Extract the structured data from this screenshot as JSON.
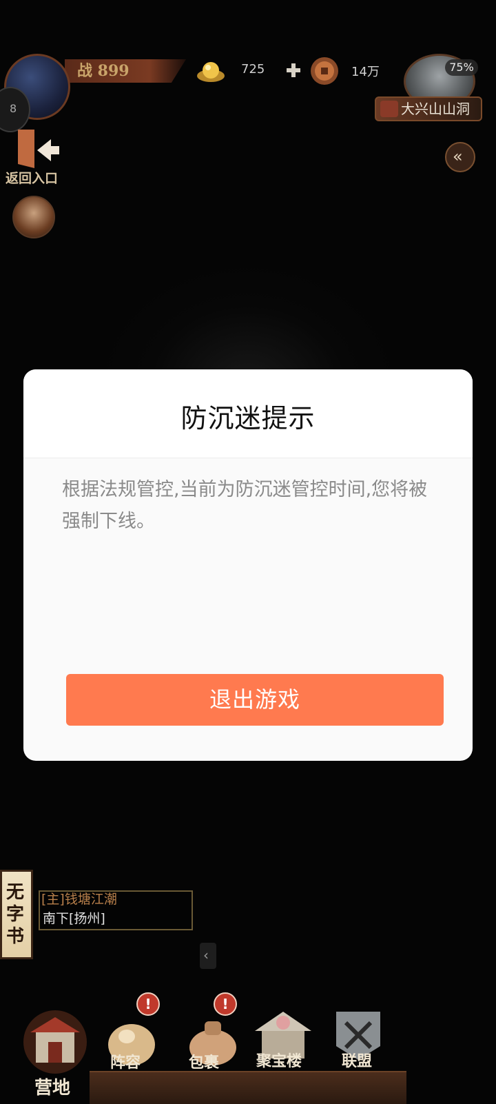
{
  "hud": {
    "power": "战 899",
    "gold": "725",
    "coins": "14万",
    "map_progress": "75%",
    "location": "大兴山山洞",
    "side_count": "8",
    "back_entrance": "返回入口"
  },
  "dialog": {
    "title": "防沉迷提示",
    "message": "根据法规管控,当前为防沉迷管控时间,您将被强制下线。",
    "exit_label": "退出游戏"
  },
  "quest": {
    "book": "无字书",
    "title": "[主]钱塘江潮",
    "subtitle": "南下[扬州]"
  },
  "nav": {
    "items": [
      {
        "label": "营地",
        "badge": ""
      },
      {
        "label": "阵容",
        "badge": "!"
      },
      {
        "label": "包裹",
        "badge": "!"
      },
      {
        "label": "聚宝楼",
        "badge": ""
      },
      {
        "label": "联盟",
        "badge": ""
      }
    ]
  },
  "colors": {
    "exit_button": "#ff7a4f",
    "badge": "#c0392b",
    "quest_title": "#b9804b"
  }
}
